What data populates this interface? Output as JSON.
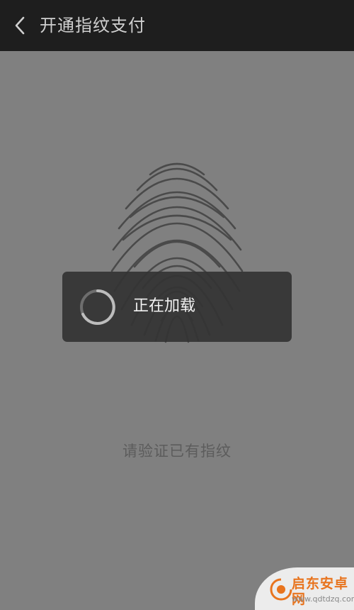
{
  "header": {
    "title": "开通指纹支付",
    "back_icon": "chevron-left-icon"
  },
  "main": {
    "fingerprint_icon": "fingerprint-icon",
    "instruction": "请验证已有指纹"
  },
  "loading_dialog": {
    "text": "正在加载",
    "spinner_icon": "spinner-icon"
  },
  "watermark": {
    "name": "启东安卓网",
    "url": "www.qdtdzq.com"
  },
  "colors": {
    "header_bg": "#1e1e1e",
    "overlay_bg": "#808080",
    "dialog_bg": "#343434",
    "brand_orange": "#e8741e"
  }
}
